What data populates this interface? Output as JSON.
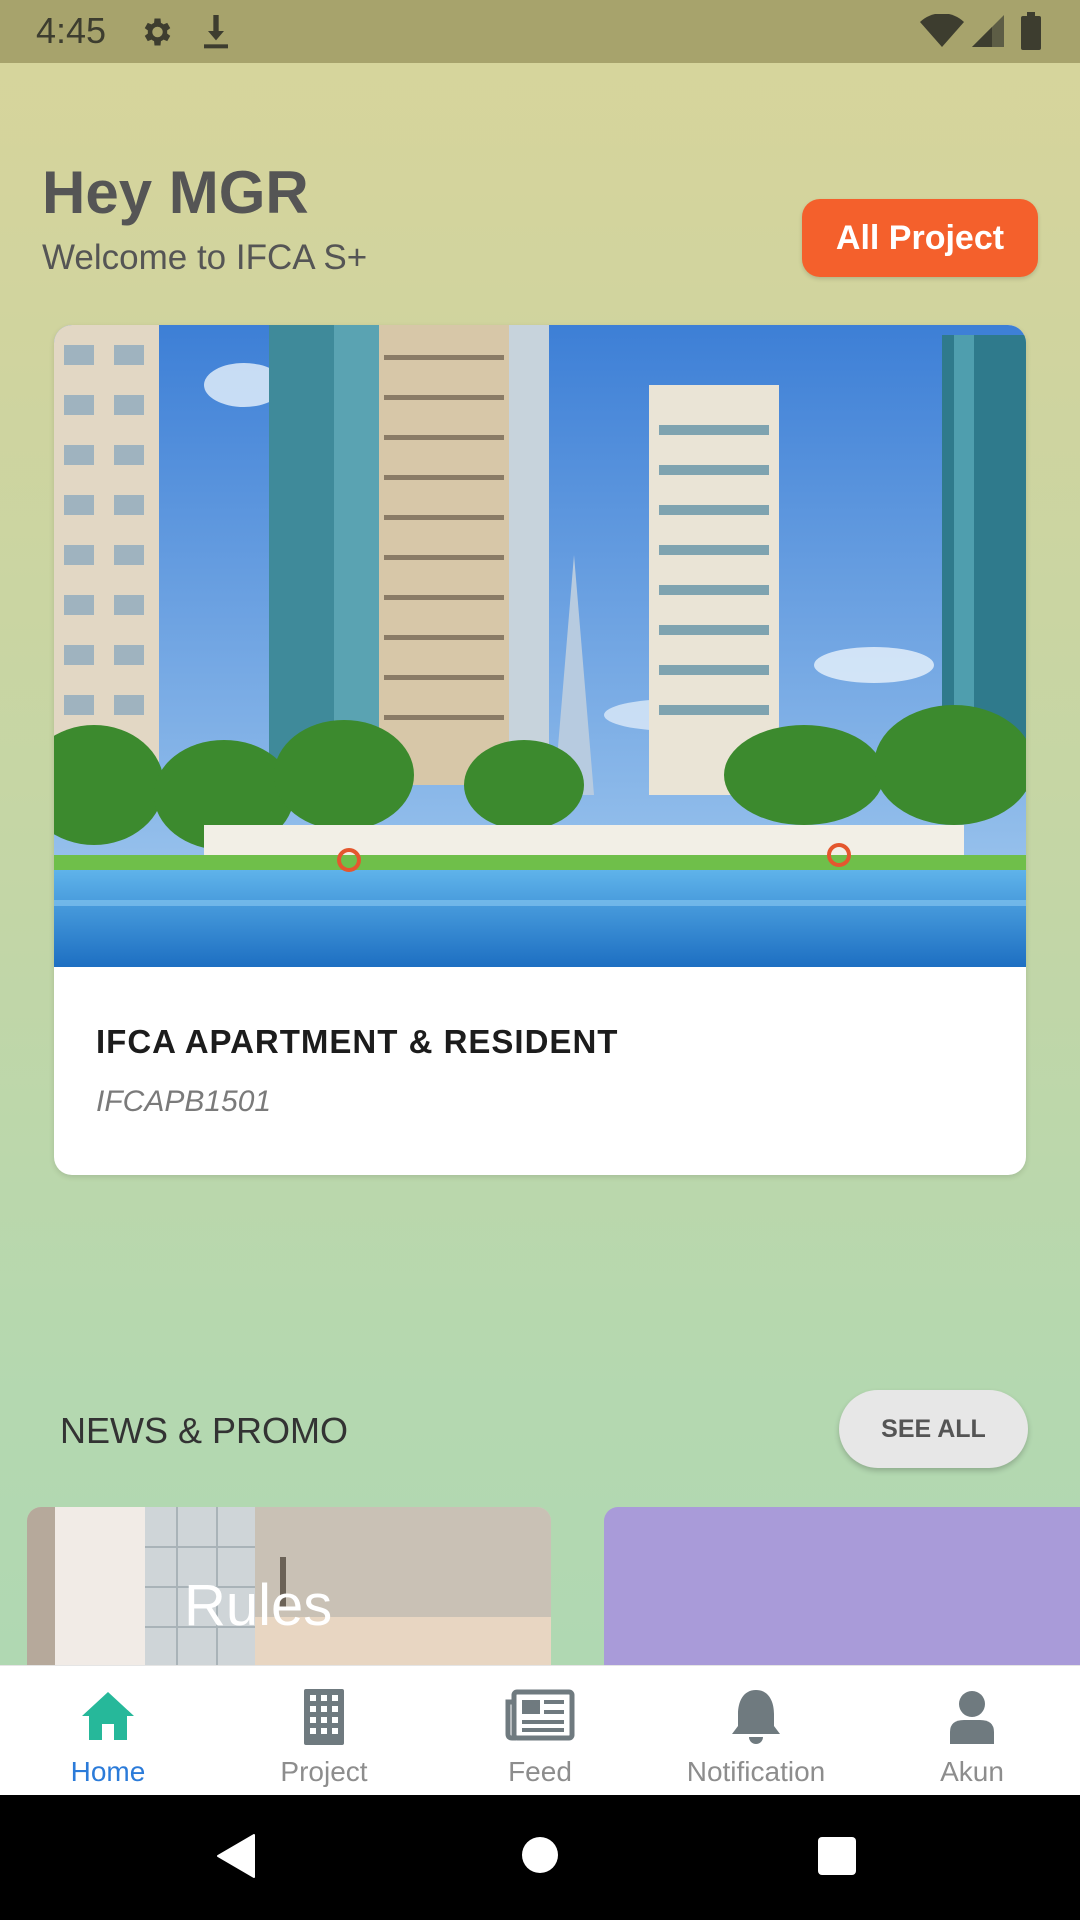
{
  "status_bar": {
    "time": "4:45"
  },
  "header": {
    "greeting": "Hey MGR",
    "welcome": "Welcome to IFCA S+",
    "all_project_label": "All Project"
  },
  "project": {
    "name": "IFCA APARTMENT & RESIDENT",
    "code": "IFCAPB1501"
  },
  "news": {
    "title": "NEWS & PROMO",
    "see_all_label": "SEE ALL",
    "cards": [
      {
        "title": ""
      },
      {
        "title": "Rules"
      }
    ]
  },
  "bottom_nav": {
    "items": [
      {
        "label": "Home",
        "icon": "home-icon",
        "active": true
      },
      {
        "label": "Project",
        "icon": "building-icon"
      },
      {
        "label": "Feed",
        "icon": "newspaper-icon"
      },
      {
        "label": "Notification",
        "icon": "bell-icon"
      },
      {
        "label": "Akun",
        "icon": "person-icon"
      }
    ]
  },
  "colors": {
    "accent": "#f4602c",
    "active_tab": "#2b7bd9",
    "home_icon": "#26b89a",
    "news_card_2": "#a99bd9"
  }
}
